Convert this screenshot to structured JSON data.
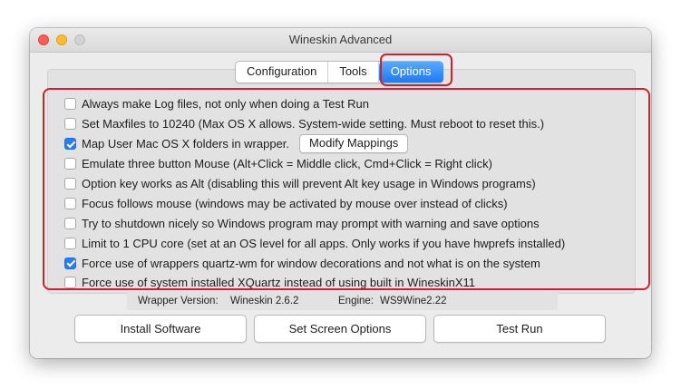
{
  "window": {
    "title": "Wineskin Advanced"
  },
  "tabs": [
    {
      "label": "Configuration",
      "selected": false
    },
    {
      "label": "Tools",
      "selected": false
    },
    {
      "label": "Options",
      "selected": true
    }
  ],
  "options": [
    {
      "label": "Always make Log files, not only when doing a Test Run",
      "checked": false
    },
    {
      "label": "Set Maxfiles to 10240 (Max OS X allows.  System-wide setting.  Must reboot to reset this.)",
      "checked": false
    },
    {
      "label": "Map User Mac OS X folders in wrapper.",
      "checked": true
    },
    {
      "label": "Emulate three button Mouse (Alt+Click = Middle click, Cmd+Click = Right click)",
      "checked": false
    },
    {
      "label": "Option key works as Alt (disabling this will prevent Alt key usage in Windows programs)",
      "checked": false
    },
    {
      "label": "Focus follows mouse (windows may be activated by mouse over instead of clicks)",
      "checked": false
    },
    {
      "label": "Try to shutdown nicely so Windows program may prompt with warning and save options",
      "checked": false
    },
    {
      "label": "Limit to 1 CPU core (set at an OS level for all apps.  Only works if you have hwprefs installed)",
      "checked": false
    },
    {
      "label": "Force use of wrappers quartz-wm for window decorations and not what is on the system",
      "checked": true
    },
    {
      "label": "Force use of system installed XQuartz instead of using built in WineskinX11",
      "checked": false
    }
  ],
  "modify_mappings_label": "Modify Mappings",
  "info": {
    "wrapper_label": "Wrapper Version:",
    "wrapper_value": "Wineskin 2.6.2",
    "engine_label": "Engine:",
    "engine_value": "WS9Wine2.22"
  },
  "buttons": {
    "install": "Install Software",
    "screen": "Set Screen Options",
    "test": "Test Run"
  },
  "colors": {
    "accent": "#1f78f5",
    "highlight": "#d0212b",
    "close": "#fd5d56",
    "minimize": "#fcbc2e"
  }
}
